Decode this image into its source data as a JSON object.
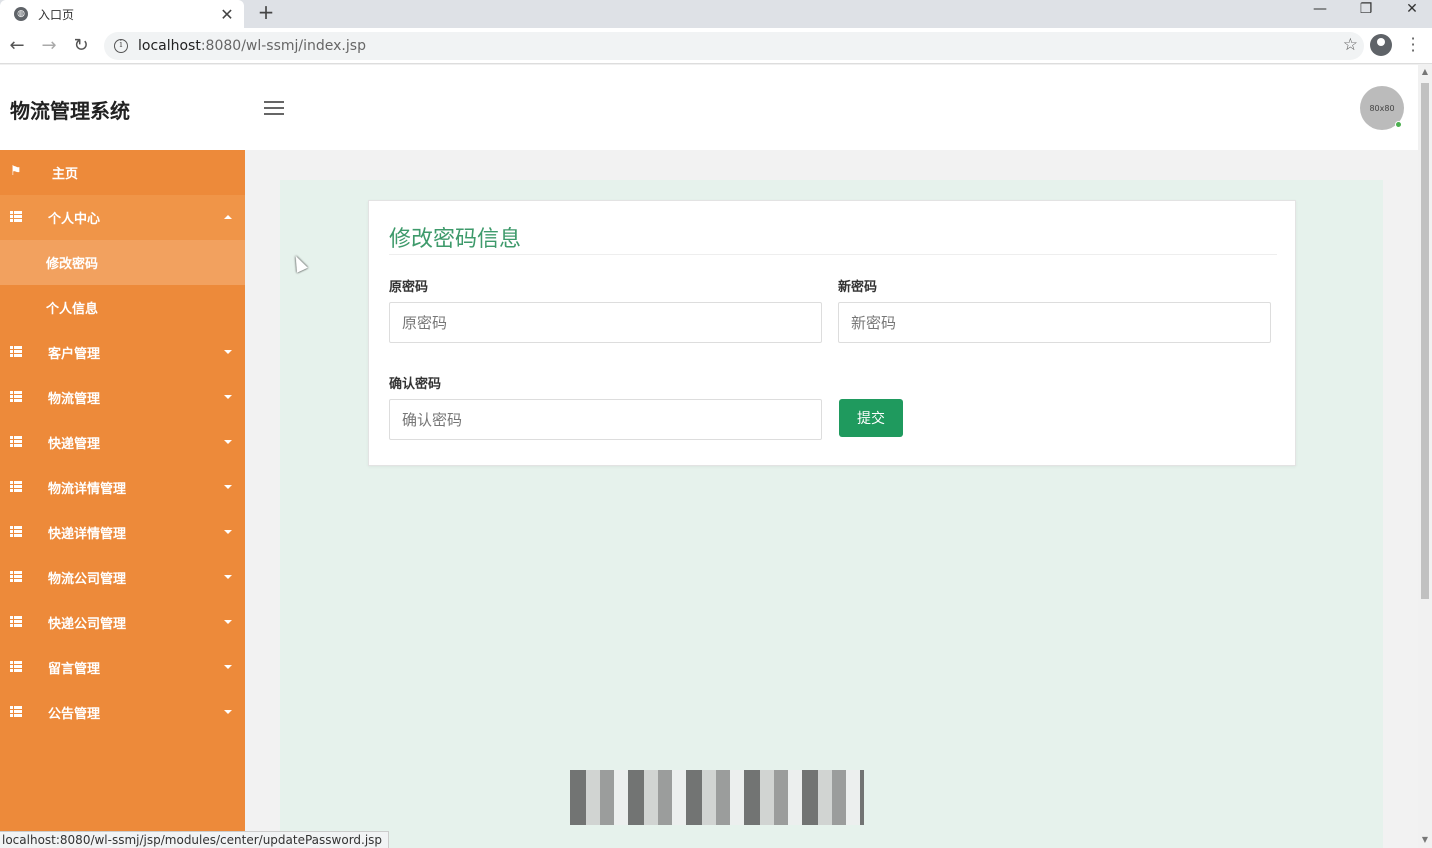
{
  "browser": {
    "tab_title": "入口页",
    "url_host": "localhost",
    "url_path": ":8080/wl-ssmj/index.jsp",
    "status_url": "localhost:8080/wl-ssmj/jsp/modules/center/updatePassword.jsp",
    "window_buttons": [
      "—",
      "❐",
      "✕"
    ]
  },
  "header": {
    "brand": "物流管理系统",
    "avatar_text": "80x80"
  },
  "sidebar": {
    "items": [
      {
        "label": "主页",
        "icon": "flag-icon"
      },
      {
        "label": "个人中心",
        "icon": "grid-icon",
        "expanded": true,
        "children": [
          {
            "label": "修改密码",
            "active": true
          },
          {
            "label": "个人信息"
          }
        ]
      },
      {
        "label": "客户管理",
        "icon": "grid-icon"
      },
      {
        "label": "物流管理",
        "icon": "grid-icon"
      },
      {
        "label": "快递管理",
        "icon": "grid-icon"
      },
      {
        "label": "物流详情管理",
        "icon": "grid-icon"
      },
      {
        "label": "快递详情管理",
        "icon": "grid-icon"
      },
      {
        "label": "物流公司管理",
        "icon": "grid-icon"
      },
      {
        "label": "快递公司管理",
        "icon": "grid-icon"
      },
      {
        "label": "留言管理",
        "icon": "grid-icon"
      },
      {
        "label": "公告管理",
        "icon": "grid-icon"
      }
    ]
  },
  "form": {
    "title": "修改密码信息",
    "old_password": {
      "label": "原密码",
      "placeholder": "原密码",
      "value": ""
    },
    "new_password": {
      "label": "新密码",
      "placeholder": "新密码",
      "value": ""
    },
    "confirm_password": {
      "label": "确认密码",
      "placeholder": "确认密码",
      "value": ""
    },
    "submit_label": "提交"
  },
  "colors": {
    "sidebar": "#ed8a3a",
    "accent_green": "#1f9a5e",
    "title_green": "#3e9a6b",
    "content_bg": "#e6f2ec"
  }
}
